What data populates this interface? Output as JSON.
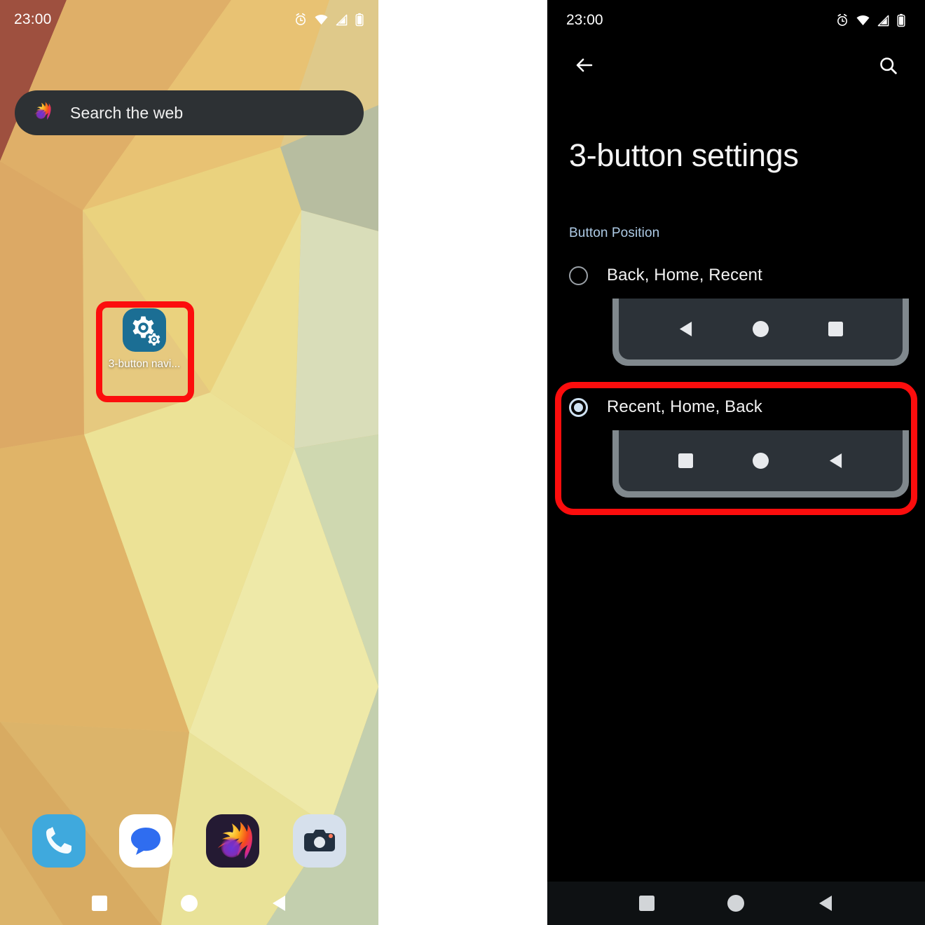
{
  "home_screen": {
    "status_bar": {
      "time": "23:00",
      "icons": [
        "alarm-icon",
        "wifi-icon",
        "cellular-signal-icon",
        "battery-icon"
      ]
    },
    "search_widget": {
      "placeholder": "Search the web",
      "icon": "firefox-icon"
    },
    "app_shortcut": {
      "label": "3-button navi...",
      "icon": "settings-gears-icon",
      "icon_bg": "#1b6e94",
      "highlighted": true,
      "highlight_color": "#fc0d0d"
    },
    "dock": [
      {
        "name": "Phone",
        "icon": "phone-icon",
        "bg": "#3fa9dd"
      },
      {
        "name": "Messages",
        "icon": "messages-icon",
        "bg": "#ffffff"
      },
      {
        "name": "Firefox",
        "icon": "firefox-icon",
        "bg": "#241a33"
      },
      {
        "name": "Camera",
        "icon": "camera-icon",
        "bg": "#d6e0ec"
      }
    ],
    "nav_bar": {
      "order": [
        "Recent",
        "Home",
        "Back"
      ],
      "glyphs": [
        "square-recent-icon",
        "circle-home-icon",
        "triangle-back-icon"
      ]
    }
  },
  "settings_screen": {
    "status_bar": {
      "time": "23:00",
      "icons": [
        "alarm-icon",
        "wifi-icon",
        "cellular-signal-icon",
        "battery-icon"
      ]
    },
    "app_bar": {
      "back": "back-arrow-icon",
      "search": "search-icon"
    },
    "title": "3-button settings",
    "section_label": "Button Position",
    "accent_color": "#aecbe6",
    "options": [
      {
        "label": "Back, Home, Recent",
        "selected": false,
        "preview_order": [
          "triangle-back-icon",
          "circle-home-icon",
          "square-recent-icon"
        ],
        "highlighted": false
      },
      {
        "label": "Recent, Home, Back",
        "selected": true,
        "preview_order": [
          "square-recent-icon",
          "circle-home-icon",
          "triangle-back-icon"
        ],
        "highlighted": true,
        "highlight_color": "#fc0d0d"
      }
    ],
    "nav_bar": {
      "order": [
        "Recent",
        "Home",
        "Back"
      ],
      "glyphs": [
        "square-recent-icon",
        "circle-home-icon",
        "triangle-back-icon"
      ]
    }
  }
}
